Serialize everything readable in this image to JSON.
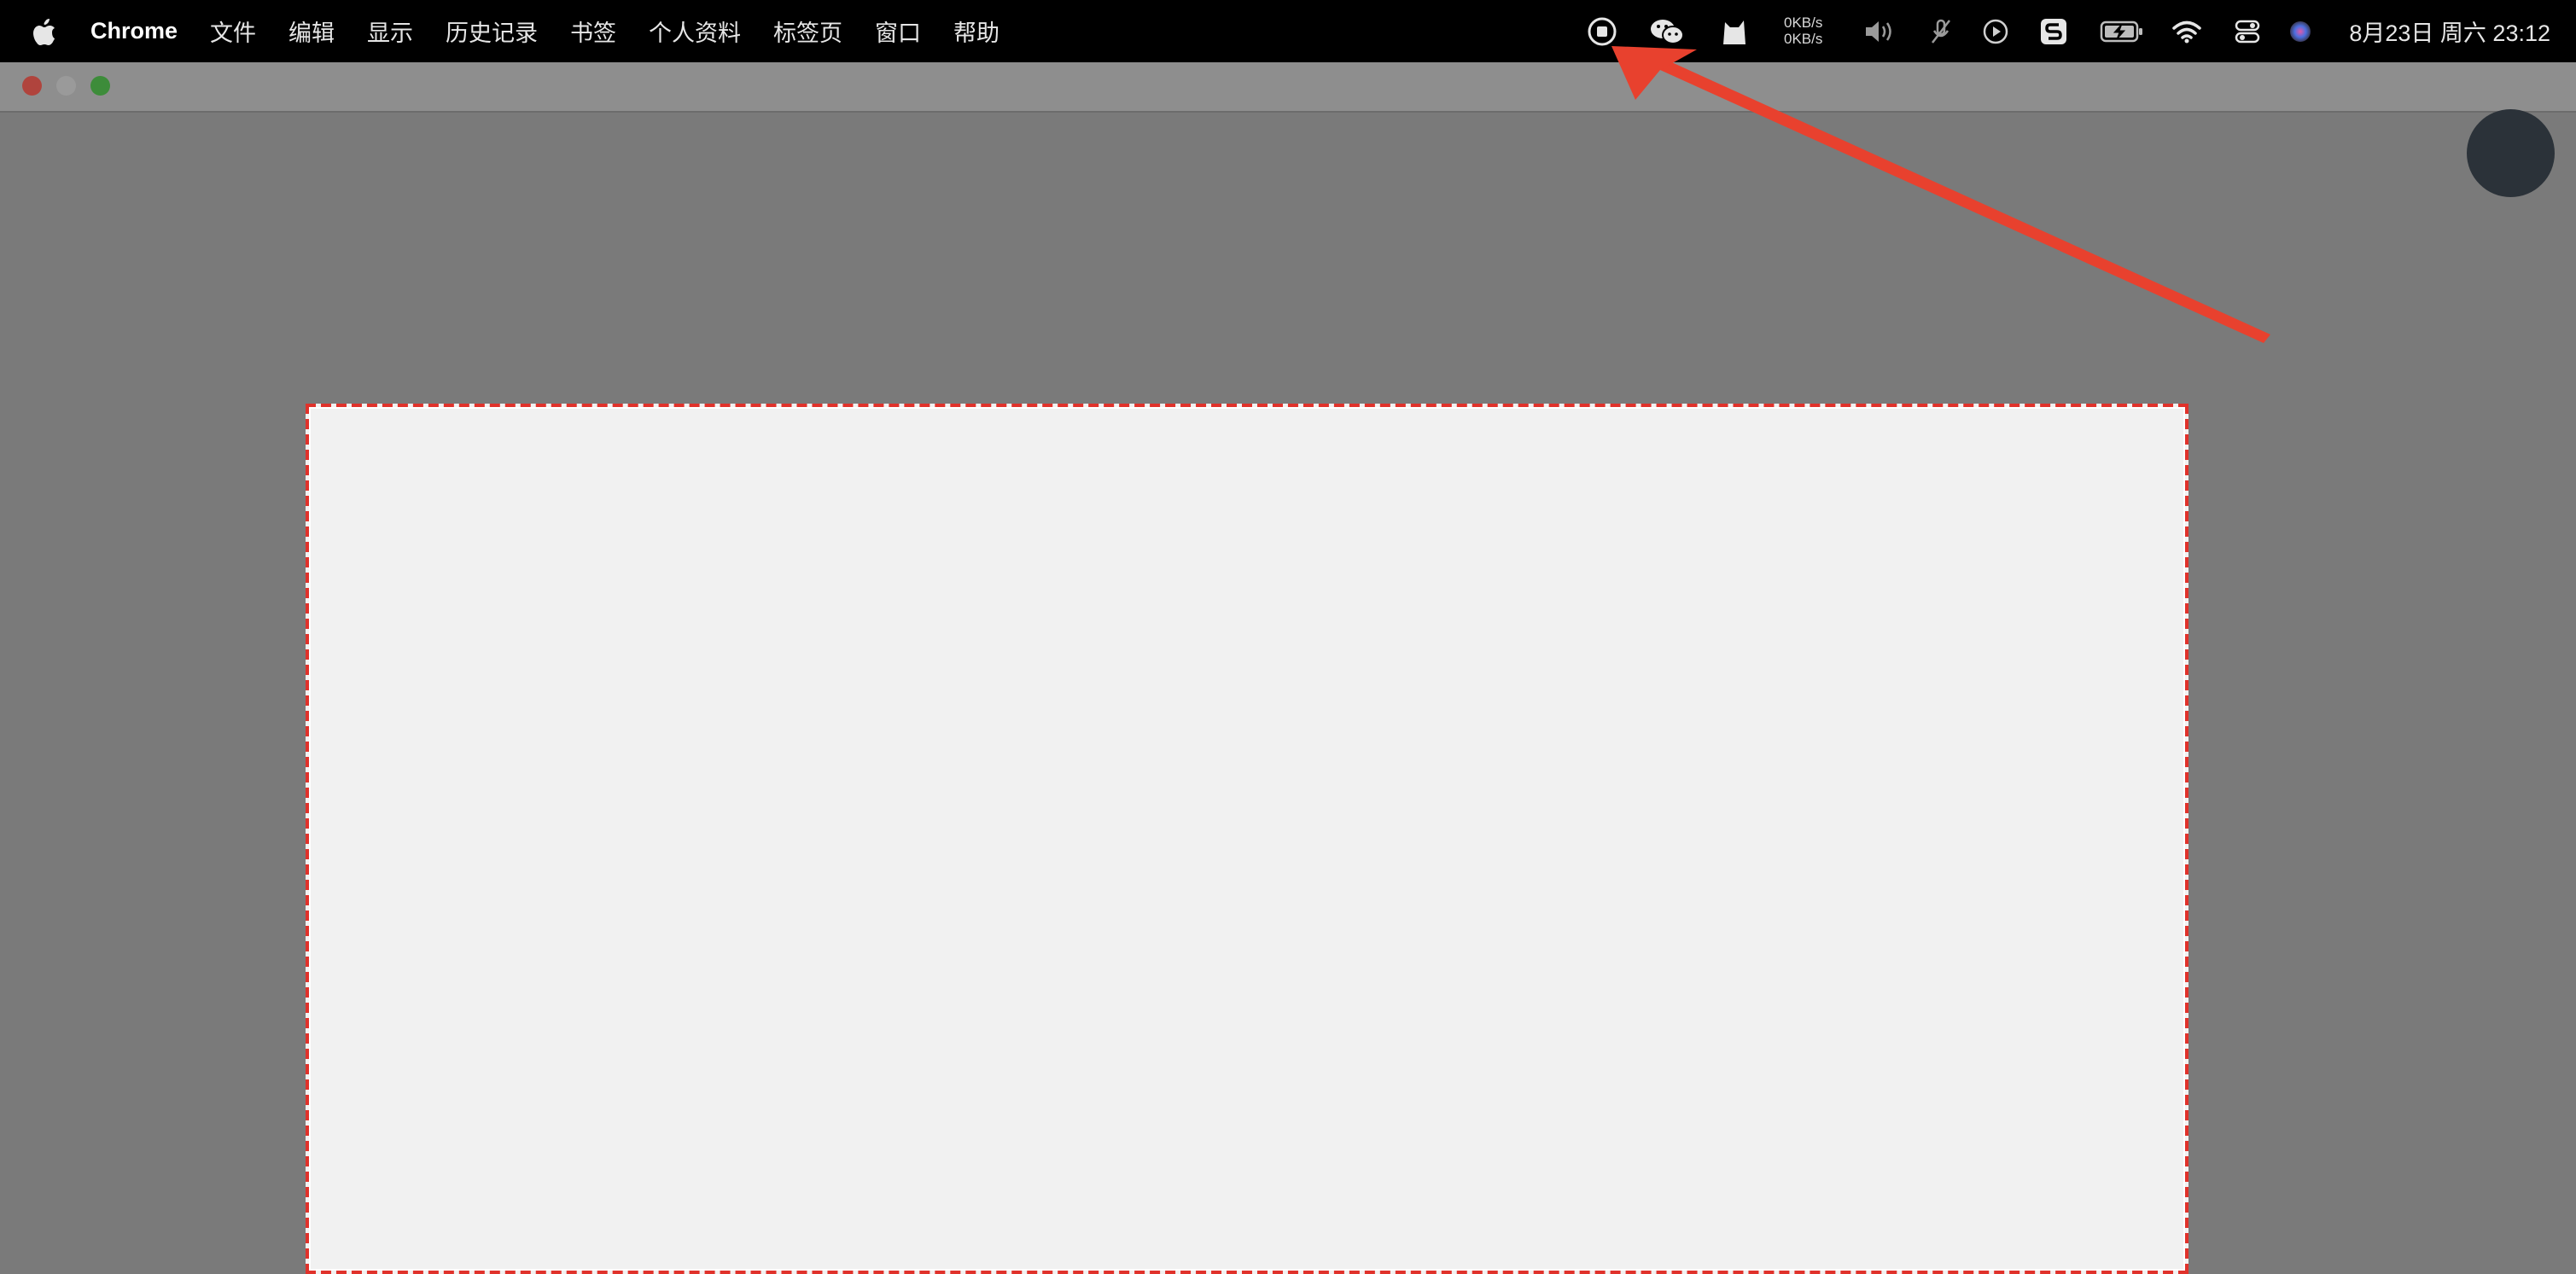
{
  "menubar": {
    "app_name": "Chrome",
    "items": [
      {
        "label": "文件"
      },
      {
        "label": "编辑"
      },
      {
        "label": "显示"
      },
      {
        "label": "历史记录"
      },
      {
        "label": "书签"
      },
      {
        "label": "个人资料"
      },
      {
        "label": "标签页"
      },
      {
        "label": "窗口"
      },
      {
        "label": "帮助"
      }
    ],
    "status": {
      "net_up": "0KB/s",
      "net_down": "0KB/s",
      "clock": "8月23日 周六  23:12"
    },
    "icons": [
      "apple-icon",
      "screen-record-icon",
      "wechat-icon",
      "cat-app-icon",
      "volume-icon",
      "mic-off-icon",
      "play-icon",
      "sogou-input-icon",
      "battery-charging-icon",
      "wifi-icon",
      "control-center-icon",
      "siri-icon"
    ]
  },
  "window": {
    "traffic_lights": [
      "close",
      "minimize",
      "zoom"
    ]
  },
  "colors": {
    "menubar_bg": "#000000",
    "desktop_bg": "#7a7a7a",
    "annotation_red": "#e8412e",
    "selection_border": "#e0322b",
    "selection_fill": "#f1f1f1",
    "close": "#b0443d",
    "minimize": "#9a9a9a",
    "zoom": "#3d8c3a"
  }
}
